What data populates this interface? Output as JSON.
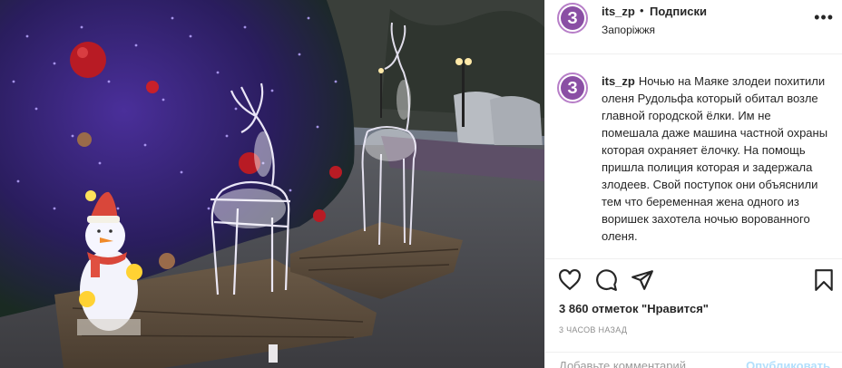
{
  "post": {
    "username": "its_zp",
    "separator": "•",
    "follow_label": "Подписки",
    "location": "Запоріжжя",
    "avatar_letter": "З",
    "caption": "Ночью на Маяке злодеи похитили оленя Рудольфа который обитал возле главной городской ёлки. Им не помешала даже машина частной охраны которая охраняет ёлочку. На помощь пришла полиция которая и задержала злодеев. Свой поступок они объяснили тем что беременная жена одного из воришек захотела ночью ворованного оленя.",
    "likes": "3 860 отметок \"Нравится\"",
    "time_ago": "3 часов назад",
    "add_comment_placeholder": "Добавьте комментарий...",
    "publish_label": "Опубликовать"
  },
  "icons": {
    "more": "more-options-icon",
    "like": "heart-icon",
    "comment": "comment-icon",
    "share": "share-icon",
    "save": "bookmark-icon"
  },
  "colors": {
    "avatar_bg": "#8a4fa4",
    "avatar_ring": "#b77ec8",
    "text": "#262626",
    "muted": "#8e8e8e"
  }
}
